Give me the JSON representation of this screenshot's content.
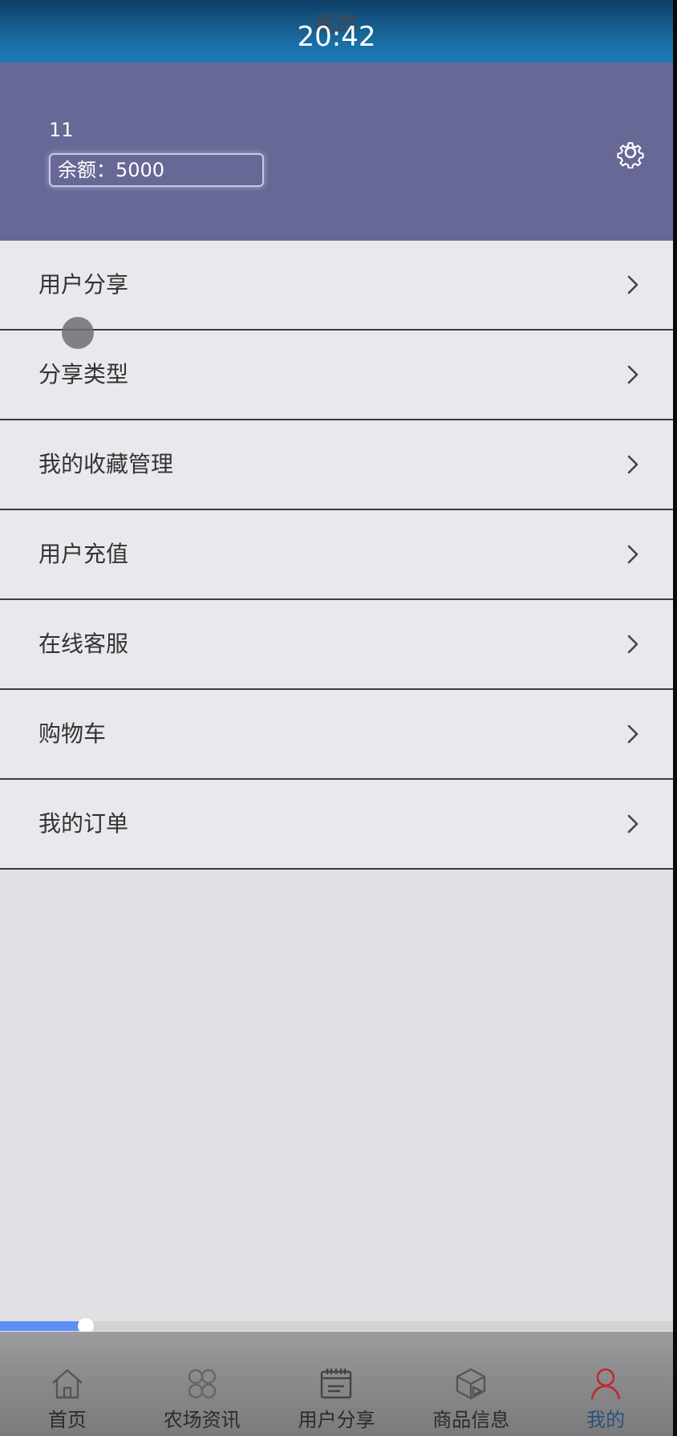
{
  "header": {
    "title": "我的",
    "clock": "20:42"
  },
  "profile": {
    "username": "11",
    "balance": "余额：5000"
  },
  "menu": {
    "items": [
      {
        "label": "用户分享"
      },
      {
        "label": "分享类型"
      },
      {
        "label": "我的收藏管理"
      },
      {
        "label": "用户充值"
      },
      {
        "label": "在线客服"
      },
      {
        "label": "购物车"
      },
      {
        "label": "我的订单"
      }
    ]
  },
  "video": {
    "progress": 0.127
  },
  "tabbar": {
    "tabs": [
      {
        "label": "首页",
        "icon": "home-icon"
      },
      {
        "label": "农场资讯",
        "icon": "grid-icon"
      },
      {
        "label": "用户分享",
        "icon": "calendar-icon"
      },
      {
        "label": "商品信息",
        "icon": "box-icon"
      },
      {
        "label": "我的",
        "icon": "user-icon",
        "active": true
      }
    ]
  },
  "colors": {
    "header": "#1a6fa6",
    "profile_bg": "#686896",
    "menu_bg": "#eae8ec",
    "active_tab": "#c0282d",
    "seek_fill": "#5b8ff5"
  }
}
